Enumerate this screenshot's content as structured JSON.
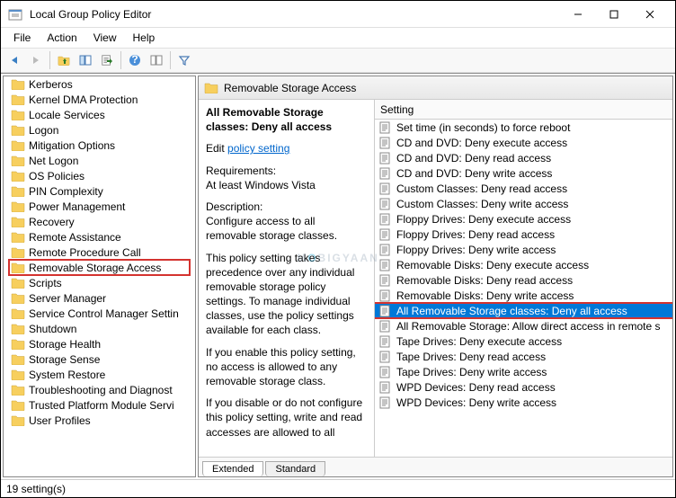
{
  "window": {
    "title": "Local Group Policy Editor"
  },
  "menu": [
    "File",
    "Action",
    "View",
    "Help"
  ],
  "tree": [
    {
      "label": "Kerberos",
      "hl": false
    },
    {
      "label": "Kernel DMA Protection",
      "hl": false
    },
    {
      "label": "Locale Services",
      "hl": false
    },
    {
      "label": "Logon",
      "hl": false
    },
    {
      "label": "Mitigation Options",
      "hl": false
    },
    {
      "label": "Net Logon",
      "hl": false
    },
    {
      "label": "OS Policies",
      "hl": false
    },
    {
      "label": "PIN Complexity",
      "hl": false
    },
    {
      "label": "Power Management",
      "hl": false
    },
    {
      "label": "Recovery",
      "hl": false
    },
    {
      "label": "Remote Assistance",
      "hl": false
    },
    {
      "label": "Remote Procedure Call",
      "hl": false
    },
    {
      "label": "Removable Storage Access",
      "hl": true
    },
    {
      "label": "Scripts",
      "hl": false
    },
    {
      "label": "Server Manager",
      "hl": false
    },
    {
      "label": "Service Control Manager Settin",
      "hl": false
    },
    {
      "label": "Shutdown",
      "hl": false
    },
    {
      "label": "Storage Health",
      "hl": false
    },
    {
      "label": "Storage Sense",
      "hl": false
    },
    {
      "label": "System Restore",
      "hl": false
    },
    {
      "label": "Troubleshooting and Diagnost",
      "hl": false
    },
    {
      "label": "Trusted Platform Module Servi",
      "hl": false
    },
    {
      "label": "User Profiles",
      "hl": false
    }
  ],
  "panel": {
    "header": "Removable Storage Access",
    "selected_title": "All Removable Storage classes: Deny all access",
    "edit_link": "policy setting",
    "edit_prefix": "Edit ",
    "req_label": "Requirements:",
    "req_value": "At least Windows Vista",
    "desc_label": "Description:",
    "desc_value": "Configure access to all removable storage classes.",
    "para1": "This policy setting takes precedence over any individual removable storage policy settings. To manage individual classes, use the policy settings available for each class.",
    "para2": "If you enable this policy setting, no access is allowed to any removable storage class.",
    "para3": "If you disable or do not configure this policy setting, write and read accesses are allowed to all"
  },
  "column_header": "Setting",
  "settings": [
    {
      "label": "Set time (in seconds) to force reboot",
      "sel": false
    },
    {
      "label": "CD and DVD: Deny execute access",
      "sel": false
    },
    {
      "label": "CD and DVD: Deny read access",
      "sel": false
    },
    {
      "label": "CD and DVD: Deny write access",
      "sel": false
    },
    {
      "label": "Custom Classes: Deny read access",
      "sel": false
    },
    {
      "label": "Custom Classes: Deny write access",
      "sel": false
    },
    {
      "label": "Floppy Drives: Deny execute access",
      "sel": false
    },
    {
      "label": "Floppy Drives: Deny read access",
      "sel": false
    },
    {
      "label": "Floppy Drives: Deny write access",
      "sel": false
    },
    {
      "label": "Removable Disks: Deny execute access",
      "sel": false
    },
    {
      "label": "Removable Disks: Deny read access",
      "sel": false
    },
    {
      "label": "Removable Disks: Deny write access",
      "sel": false
    },
    {
      "label": "All Removable Storage classes: Deny all access",
      "sel": true
    },
    {
      "label": "All Removable Storage: Allow direct access in remote s",
      "sel": false
    },
    {
      "label": "Tape Drives: Deny execute access",
      "sel": false
    },
    {
      "label": "Tape Drives: Deny read access",
      "sel": false
    },
    {
      "label": "Tape Drives: Deny write access",
      "sel": false
    },
    {
      "label": "WPD Devices: Deny read access",
      "sel": false
    },
    {
      "label": "WPD Devices: Deny write access",
      "sel": false
    }
  ],
  "tabs": {
    "extended": "Extended",
    "standard": "Standard"
  },
  "status": "19 setting(s)",
  "watermark": {
    "pre": "M",
    "dot": "O",
    "post": "BIGYAAN"
  }
}
